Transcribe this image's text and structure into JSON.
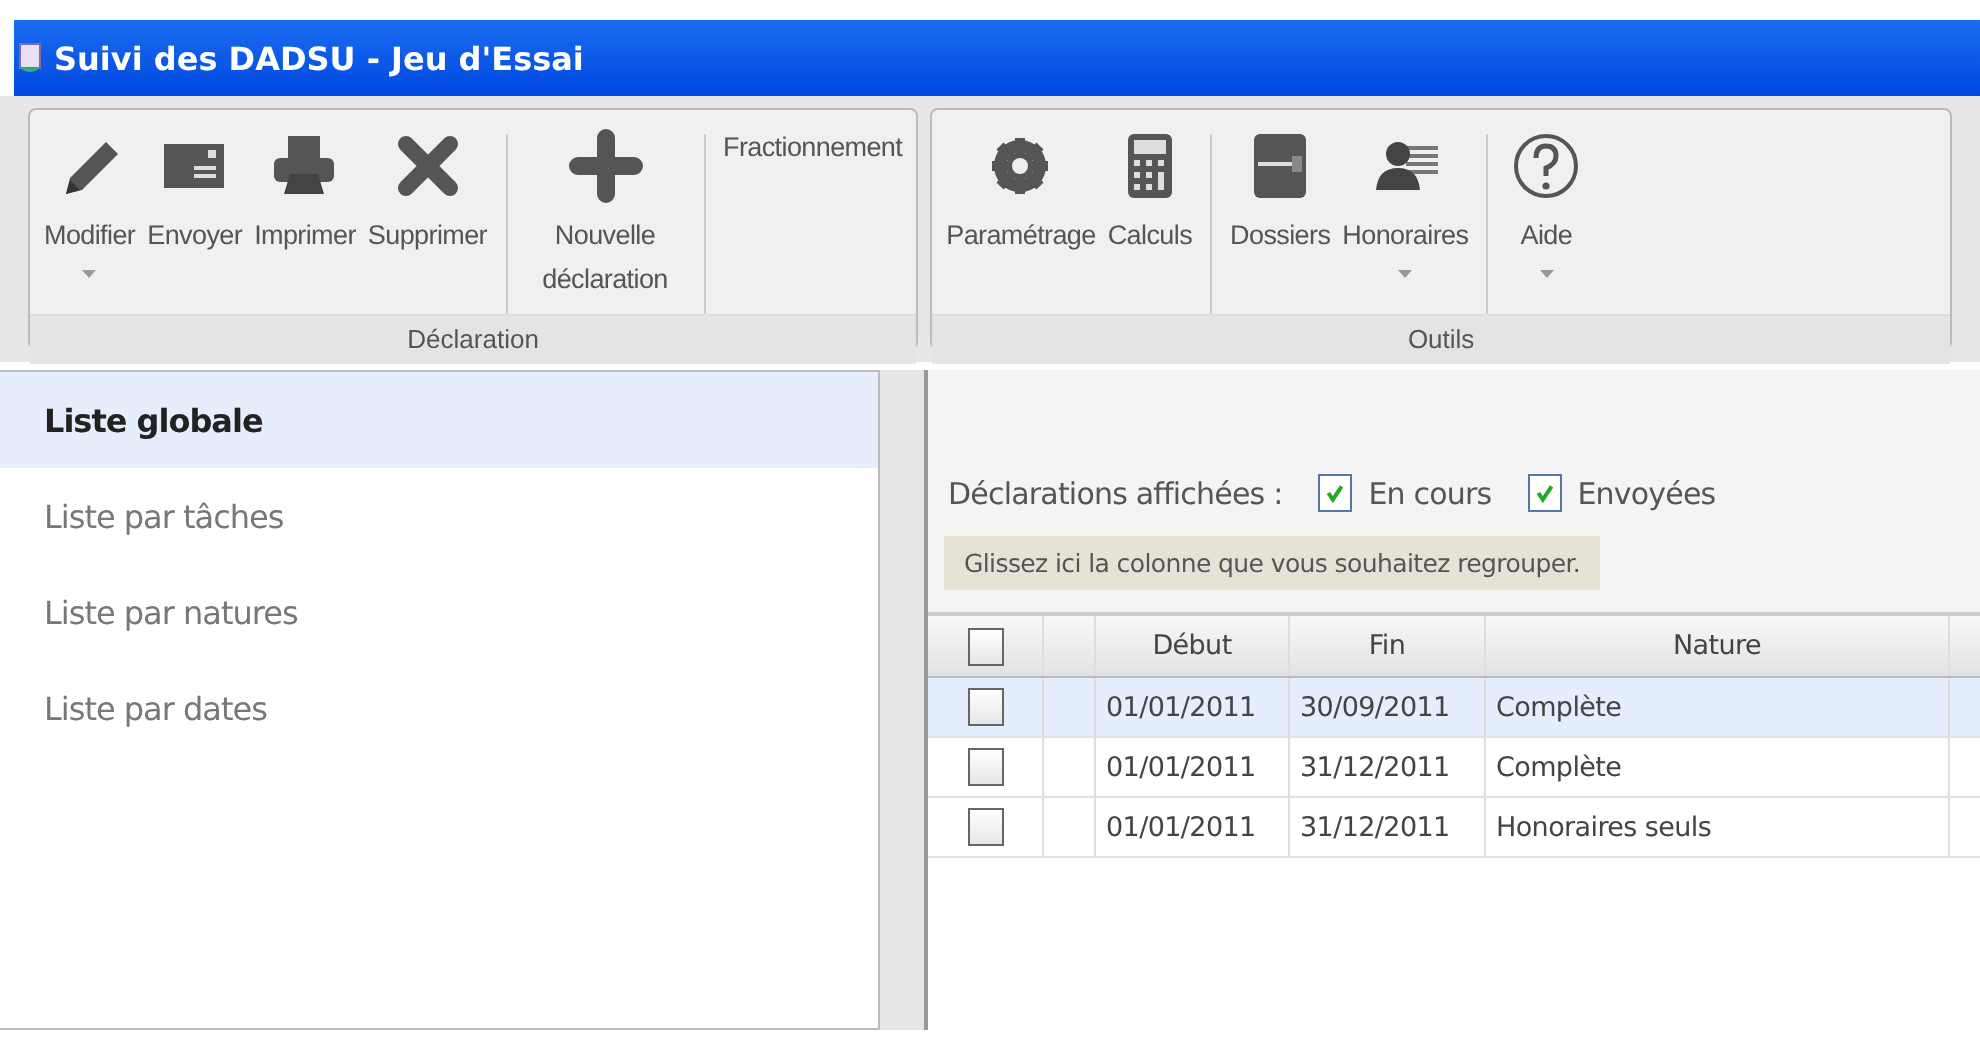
{
  "window": {
    "title": "Suivi des DADSU - Jeu d'Essai"
  },
  "ribbon": {
    "groups": [
      {
        "label": "Déclaration",
        "sections": [
          {
            "buttons": [
              {
                "label": "Modifier",
                "kind": "icon",
                "dropdown": true
              },
              {
                "label": "Envoyer",
                "kind": "icon",
                "dropdown": false
              },
              {
                "label": "Imprimer",
                "kind": "icon",
                "dropdown": false
              },
              {
                "label": "Supprimer",
                "kind": "icon",
                "dropdown": false
              }
            ]
          },
          {
            "buttons": [
              {
                "label": "Nouvelle déclaration",
                "kind": "icon",
                "dropdown": false
              }
            ]
          },
          {
            "buttons": [
              {
                "label": "Fractionnement",
                "kind": "text",
                "dropdown": false
              }
            ]
          }
        ]
      },
      {
        "label": "Outils",
        "sections": [
          {
            "buttons": [
              {
                "label": "Paramétrage",
                "kind": "icon",
                "dropdown": false
              },
              {
                "label": "Calculs",
                "kind": "icon",
                "dropdown": false
              }
            ]
          },
          {
            "buttons": [
              {
                "label": "Dossiers",
                "kind": "icon",
                "dropdown": false
              },
              {
                "label": "Honoraires",
                "kind": "icon",
                "dropdown": true
              }
            ]
          },
          {
            "buttons": [
              {
                "label": "Aide",
                "kind": "icon",
                "dropdown": true
              }
            ]
          }
        ]
      }
    ]
  },
  "sidebar": {
    "items": [
      {
        "label": "Liste globale",
        "selected": true
      },
      {
        "label": "Liste par tâches",
        "selected": false
      },
      {
        "label": "Liste par natures",
        "selected": false
      },
      {
        "label": "Liste par dates",
        "selected": false
      }
    ]
  },
  "filter": {
    "label": "Déclarations affichées :",
    "options": [
      {
        "label": "En cours",
        "checked": true
      },
      {
        "label": "Envoyées",
        "checked": true
      }
    ]
  },
  "group_hint": "Glissez ici la colonne que vous souhaitez regrouper.",
  "table": {
    "header_checked": false,
    "columns": [
      "Début",
      "Fin",
      "Nature"
    ],
    "rows": [
      {
        "checked": false,
        "selected": true,
        "cells": [
          "01/01/2011",
          "30/09/2011",
          "Complète"
        ]
      },
      {
        "checked": false,
        "selected": false,
        "cells": [
          "01/01/2011",
          "31/12/2011",
          "Complète"
        ]
      },
      {
        "checked": false,
        "selected": false,
        "cells": [
          "01/01/2011",
          "31/12/2011",
          "Honoraires seuls"
        ]
      }
    ]
  }
}
